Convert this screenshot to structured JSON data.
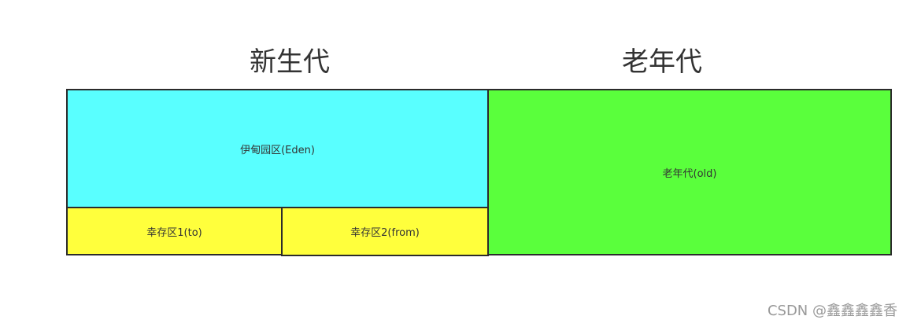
{
  "titles": {
    "young_generation": "新生代",
    "old_generation": "老年代"
  },
  "regions": {
    "eden": {
      "label": "伊甸园区(Eden)",
      "color": "#59ffff"
    },
    "survivor_to": {
      "label": "幸存区1(to)",
      "color": "#ffff3c"
    },
    "survivor_from": {
      "label": "幸存区2(from)",
      "color": "#ffff3c"
    },
    "old": {
      "label": "老年代(old)",
      "color": "#5aff3c"
    }
  },
  "watermark": "CSDN @鑫鑫鑫鑫香"
}
